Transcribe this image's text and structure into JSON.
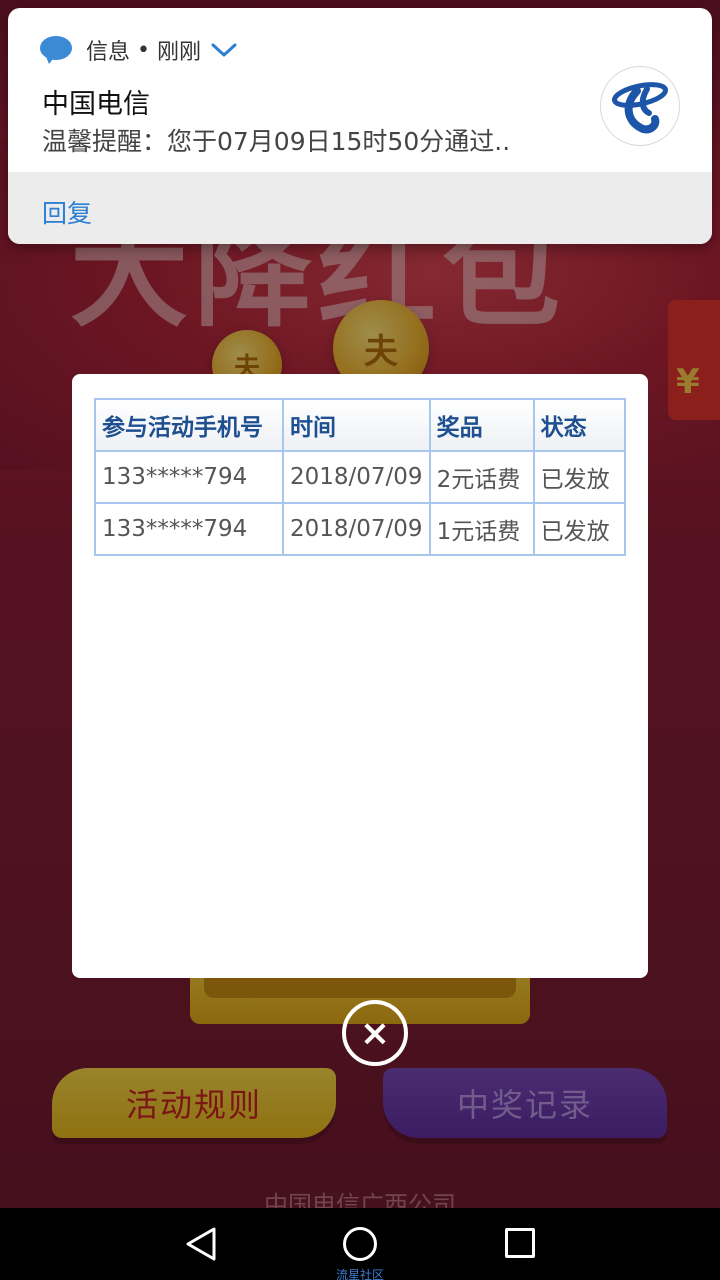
{
  "background": {
    "title_text": "大降红包",
    "coin_symbol": "夫",
    "redpack_symbol": "¥",
    "rules_button": "活动规则",
    "records_button": "中奖记录",
    "footer": "中国电信广西公司"
  },
  "notification": {
    "app_name": "信息",
    "separator": "•",
    "time": "刚刚",
    "sender": "中国电信",
    "body": "温馨提醒：您于07月09日15时50分通过..",
    "reply_label": "回复",
    "icon": "message-bubble-icon",
    "logo": "china-telecom-logo"
  },
  "modal": {
    "columns": [
      "参与活动手机号",
      "时间",
      "奖品",
      "状态"
    ],
    "rows": [
      [
        "133*****794",
        "2018/07/09",
        "2元话费",
        "已发放"
      ],
      [
        "133*****794",
        "2018/07/09",
        "1元话费",
        "已发放"
      ]
    ],
    "close_symbol": "×"
  },
  "navbar": {
    "back_icon": "back-triangle-icon",
    "home_icon": "home-circle-icon",
    "recent_icon": "recent-square-icon",
    "watermark": "流星社区"
  },
  "colors": {
    "accent_blue": "#2b7fd4",
    "table_header_text": "#1e4f91",
    "table_border": "#a9c6ee",
    "rules_button": "#f0c83a",
    "records_button": "#6c3aab"
  }
}
